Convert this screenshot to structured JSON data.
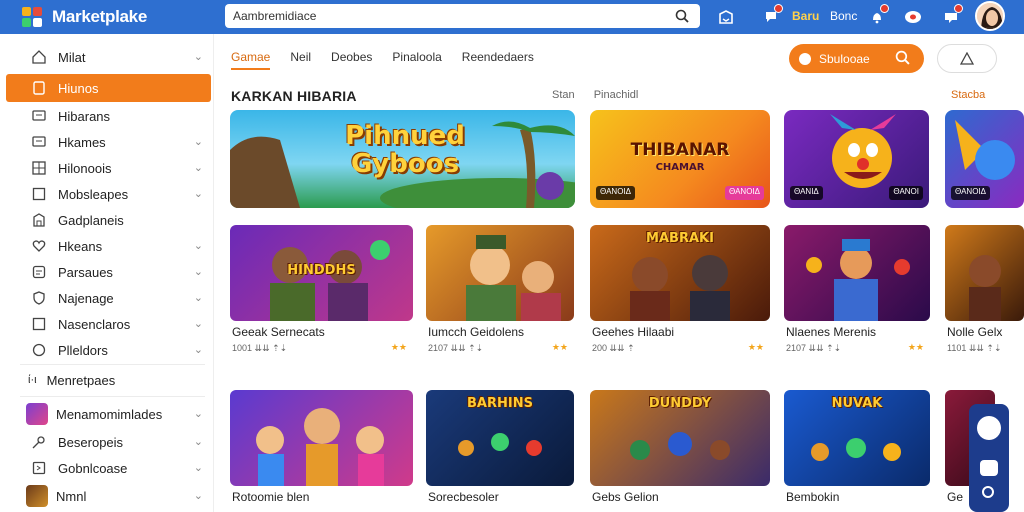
{
  "app": {
    "title": "Marketplake",
    "search_value": "Aambremidiace"
  },
  "header": {
    "brand_text": "Baru",
    "user_text": "Bonc"
  },
  "sidebar": {
    "items": [
      {
        "label": "Milat",
        "icon": "home-icon",
        "chevron": true
      },
      {
        "label": "Hiunos",
        "icon": "bookmark-icon",
        "active": true
      },
      {
        "label": "Hibarans",
        "icon": "chat-icon"
      },
      {
        "label": "Hkames",
        "icon": "chat-icon",
        "chevron": true
      },
      {
        "label": "Hilonoois",
        "icon": "grid-icon",
        "chevron": true
      },
      {
        "label": "Mobsleapes",
        "icon": "square-icon",
        "chevron": true
      },
      {
        "label": "Gadplaneis",
        "icon": "building-icon"
      },
      {
        "label": "Hkeans",
        "icon": "heart-icon",
        "chevron": true
      },
      {
        "label": "Parsaues",
        "icon": "message-icon",
        "chevron": true
      },
      {
        "label": "Najenage",
        "icon": "shield-icon",
        "chevron": true
      },
      {
        "label": "Nasenclaros",
        "icon": "square-icon",
        "chevron": true
      },
      {
        "label": "Plleldors",
        "icon": "info-icon",
        "chevron": true
      }
    ],
    "group_label": "Menretpaes",
    "group_prefix": "ί·ι",
    "bottom_items": [
      {
        "label": "Menamomimlades",
        "icon": "game-thumb-icon",
        "chevron": true
      },
      {
        "label": "Beseropeis",
        "icon": "key-icon",
        "chevron": true
      },
      {
        "label": "Gobnlcoase",
        "icon": "message-icon",
        "chevron": true
      },
      {
        "label": "Nmnl",
        "icon": "game-thumb-icon",
        "chevron": true
      }
    ]
  },
  "main": {
    "tabs": [
      "Gamae",
      "Neil",
      "Deobes",
      "Pinaloola",
      "Reendedaers"
    ],
    "promo_label": "Sbulooae",
    "section_title": "KARKAN HIBARIA",
    "section_links": [
      "Stan",
      "Pinachidl"
    ],
    "section_more": "Stacba",
    "banners": [
      {
        "text": "Pihnued Gyboos",
        "tag_left": "",
        "tag_right": ""
      },
      {
        "text": "THIBANAR",
        "sub": "CHAMAR",
        "tag_left": "ΘΑΝΟΙΔ",
        "tag_right": "ΘΑΝΟΙΔ"
      },
      {
        "text": "",
        "tag_left": "ΘΑΝΙΔ",
        "tag_right": "ΘΑΝΟΙ"
      },
      {
        "text": "",
        "tag_left": "ΘΑΝΟΙΔ",
        "tag_right": ""
      }
    ],
    "row1": [
      {
        "poster": "HINDDHS",
        "title": "Geeak Sernecats",
        "meta": "1001 ⇊⇊ ⇡⇣",
        "stars": "★★"
      },
      {
        "poster": "",
        "title": "Iumcch Geidolens",
        "meta": "2107 ⇊⇊ ⇡⇣",
        "stars": "★★"
      },
      {
        "poster": "MABRAKI",
        "title": "Geehes Hilaabi",
        "meta": "200 ⇊⇊ ⇡",
        "stars": "★★"
      },
      {
        "poster": "",
        "title": "Nlaenes Merenis",
        "meta": "2107 ⇊⇊ ⇡⇣",
        "stars": "★★"
      },
      {
        "poster": "",
        "title": "Nolle Gelx",
        "meta": "1101 ⇊⇊ ⇡⇣",
        "stars": ""
      }
    ],
    "row2": [
      {
        "poster": "",
        "title": "Rotoomie blen"
      },
      {
        "poster": "BARHINS",
        "title": "Sorecbesoler"
      },
      {
        "poster": "DUNDDY",
        "title": "Gebs Gelion"
      },
      {
        "poster": "NUVAK",
        "title": "Bembokin"
      },
      {
        "poster": "",
        "title": "Ge"
      }
    ]
  },
  "colors": {
    "topbar": "#2e6fd0",
    "accent": "#f27c1b"
  }
}
